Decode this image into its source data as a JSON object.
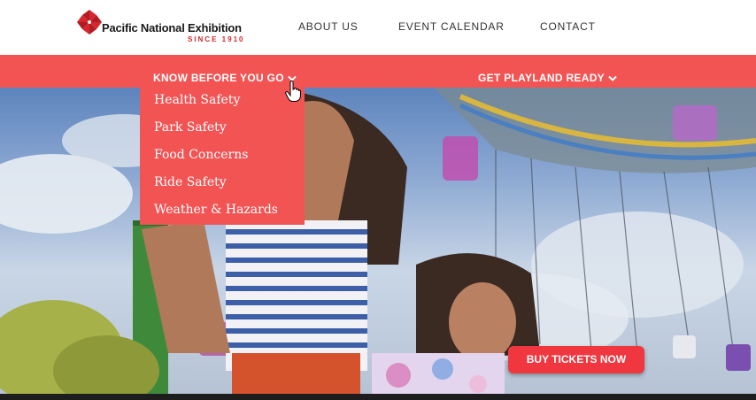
{
  "logo": {
    "title": "Pacific National Exhibition",
    "since": "SINCE 1910"
  },
  "nav": {
    "about": "ABOUT US",
    "events": "EVENT CALENDAR",
    "contact": "CONTACT"
  },
  "subnav": {
    "know_before": "KNOW BEFORE YOU GO",
    "playland_ready": "GET PLAYLAND READY"
  },
  "dropdown": {
    "items": [
      "Health Safety",
      "Park Safety",
      "Food Concerns",
      "Ride Safety",
      "Weather & Hazards"
    ]
  },
  "cta": {
    "buy_tickets": "BUY TICKETS NOW"
  },
  "colors": {
    "accent": "#f25454",
    "cta": "#f0373f",
    "logo_red": "#d7262e"
  },
  "icons": [
    "pinwheel-logo-icon",
    "chevron-down-icon",
    "hand-pointer-cursor"
  ]
}
